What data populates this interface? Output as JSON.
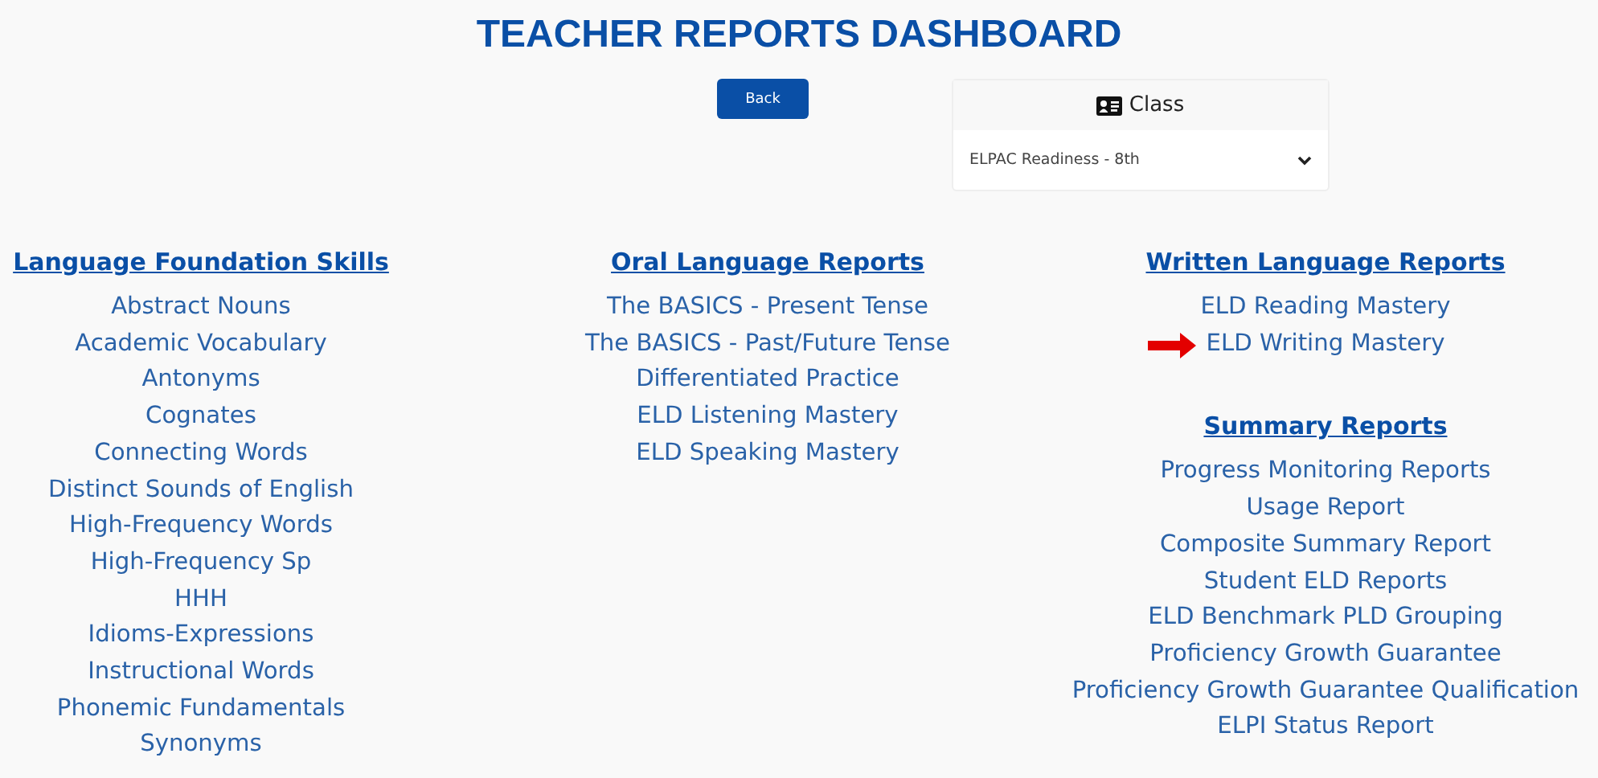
{
  "title": "TEACHER REPORTS DASHBOARD",
  "back_button": "Back",
  "class_selector": {
    "label": "Class",
    "value": "ELPAC Readiness - 8th"
  },
  "columns": [
    {
      "sections": [
        {
          "heading": "Language Foundation Skills",
          "links": [
            {
              "label": "Abstract Nouns",
              "marked": false
            },
            {
              "label": "Academic Vocabulary",
              "marked": false
            },
            {
              "label": "Antonyms",
              "marked": false
            },
            {
              "label": "Cognates",
              "marked": false
            },
            {
              "label": "Connecting Words",
              "marked": false
            },
            {
              "label": "Distinct Sounds of English",
              "marked": false
            },
            {
              "label": "High-Frequency Words",
              "marked": false
            },
            {
              "label": "High-Frequency Sp",
              "marked": false
            },
            {
              "label": "HHH",
              "marked": false
            },
            {
              "label": "Idioms-Expressions",
              "marked": false
            },
            {
              "label": "Instructional Words",
              "marked": false
            },
            {
              "label": "Phonemic Fundamentals",
              "marked": false
            },
            {
              "label": "Synonyms",
              "marked": false
            }
          ]
        }
      ]
    },
    {
      "sections": [
        {
          "heading": "Oral Language Reports",
          "links": [
            {
              "label": "The BASICS - Present Tense",
              "marked": false
            },
            {
              "label": "The BASICS - Past/Future Tense",
              "marked": false
            },
            {
              "label": "Differentiated Practice",
              "marked": false
            },
            {
              "label": "ELD Listening Mastery",
              "marked": false
            },
            {
              "label": "ELD Speaking Mastery",
              "marked": false
            }
          ]
        }
      ]
    },
    {
      "sections": [
        {
          "heading": "Written Language Reports",
          "links": [
            {
              "label": "ELD Reading Mastery",
              "marked": false
            },
            {
              "label": "ELD Writing Mastery",
              "marked": true
            }
          ]
        },
        {
          "heading": "Summary Reports",
          "links": [
            {
              "label": "Progress Monitoring Reports",
              "marked": false
            },
            {
              "label": "Usage Report",
              "marked": false
            },
            {
              "label": "Composite Summary Report",
              "marked": false
            },
            {
              "label": "Student ELD Reports",
              "marked": false
            },
            {
              "label": "ELD Benchmark PLD Grouping",
              "marked": false
            },
            {
              "label": "Proficiency Growth Guarantee",
              "marked": false
            },
            {
              "label": "Proficiency Growth Guarantee Qualification",
              "marked": false
            },
            {
              "label": "ELPI Status Report",
              "marked": false
            }
          ]
        }
      ]
    }
  ]
}
